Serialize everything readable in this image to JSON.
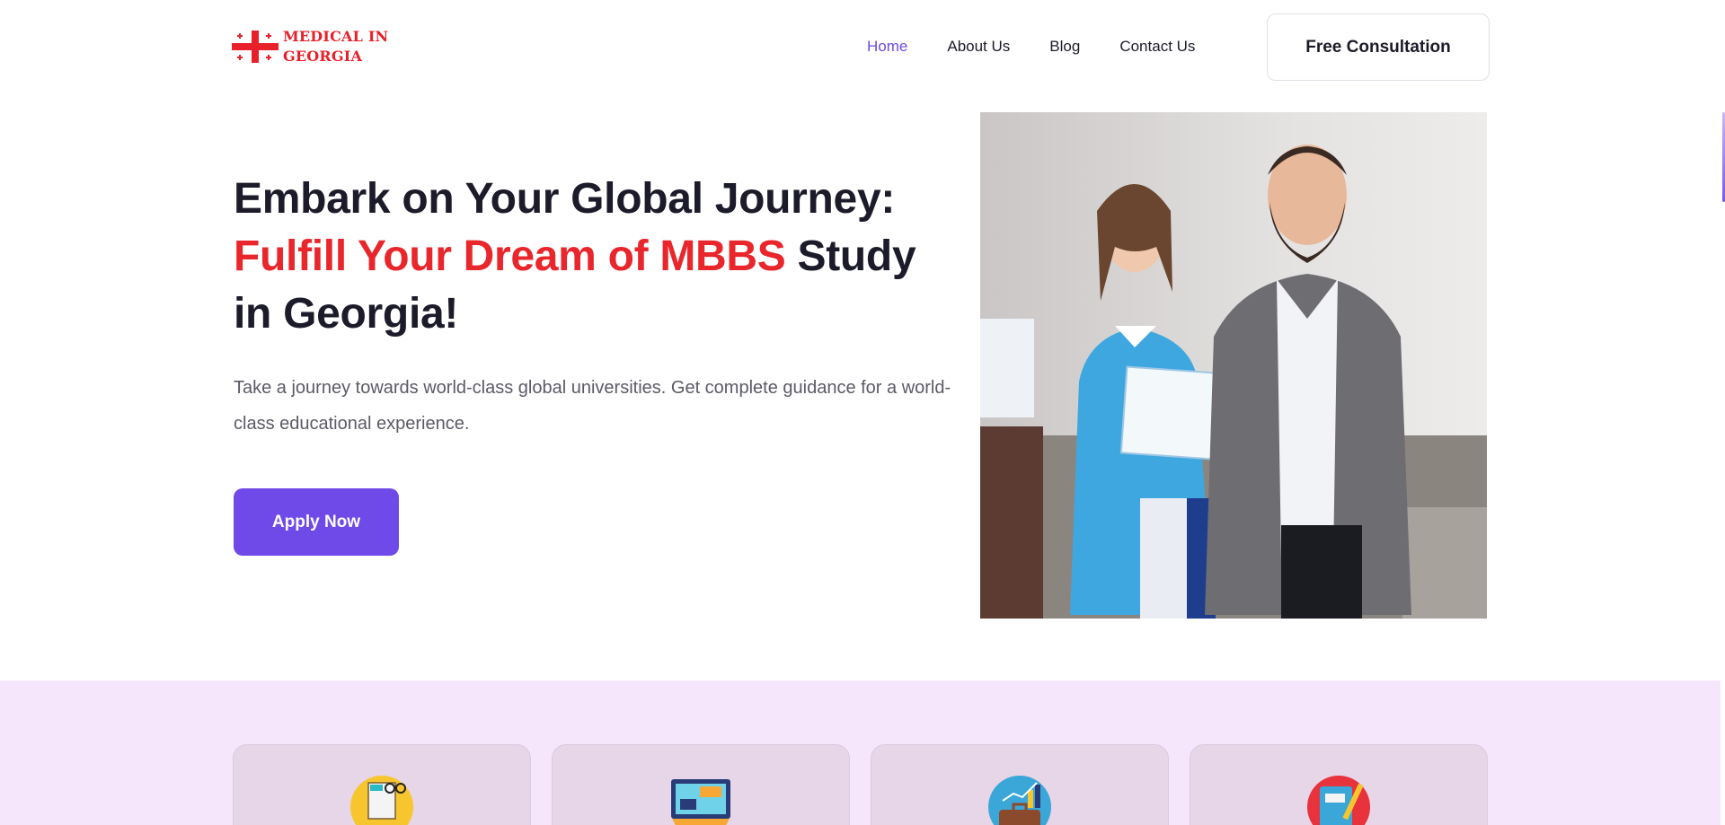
{
  "logo": {
    "line1": "MEDICAL IN",
    "line2": "GEORGIA",
    "brand_red": "#e8202a"
  },
  "nav": {
    "items": [
      {
        "label": "Home",
        "active": true
      },
      {
        "label": "About Us",
        "active": false
      },
      {
        "label": "Blog",
        "active": false
      },
      {
        "label": "Contact Us",
        "active": false
      }
    ],
    "active_color": "#6c4be0"
  },
  "header": {
    "consult_label": "Free Consultation"
  },
  "hero": {
    "title_part1": "Embark on Your Global Journey:",
    "title_highlight": "Fulfill Your Dream of MBBS",
    "title_part2": " Study in Georgia!",
    "highlight_color": "#e8262b",
    "description": "Take a journey towards world-class global universities. Get complete guidance for a world-class educational experience.",
    "apply_label": "Apply Now",
    "apply_color": "#6f4ae8",
    "photo": "certificate-presentation-photo"
  },
  "features": {
    "band_color": "#f6e6fb",
    "cards": [
      {
        "icon": "news-glasses-icon"
      },
      {
        "icon": "monitor-dashboard-icon"
      },
      {
        "icon": "briefcase-growth-icon"
      },
      {
        "icon": "notebook-pencil-icon"
      }
    ]
  }
}
